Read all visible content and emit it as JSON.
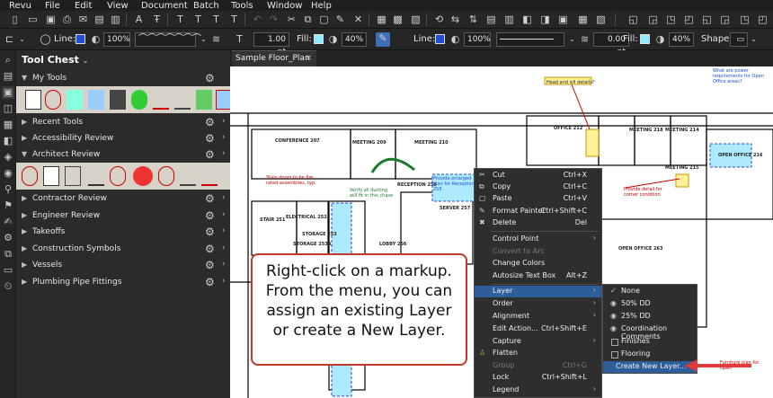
{
  "menubar": {
    "items": [
      "Revu",
      "File",
      "Edit",
      "View",
      "Document",
      "Batch",
      "Tools",
      "Window",
      "Help"
    ]
  },
  "toolbar2": {
    "line_label": "Line:",
    "line_zoom": "100%",
    "stroke_width": "1.00 pt",
    "fill_label": "Fill:",
    "fill_opacity": "40%",
    "line2_label": "Line:",
    "line2_zoom": "100%",
    "stroke2_width": "0.00 pt",
    "fill2_label": "Fill:",
    "fill2_opacity": "40%",
    "shape_label": "Shape:",
    "colors": {
      "line": "#1f4fd6",
      "fill": "#8fe8ff"
    }
  },
  "toolchest": {
    "title": "Tool Chest",
    "sections": [
      "My Tools",
      "Recent Tools",
      "Accessibility Review",
      "Architect Review",
      "Contractor Review",
      "Engineer Review",
      "Takeoffs",
      "Construction Symbols",
      "Vessels",
      "Plumbing Pipe Fittings"
    ]
  },
  "tab": {
    "label": "Sample Floor_Plan",
    "close": "×"
  },
  "context_menu": {
    "items": [
      {
        "label": "Cut",
        "shortcut": "Ctrl+X",
        "icon": "scissors-icon",
        "disabled": false
      },
      {
        "label": "Copy",
        "shortcut": "Ctrl+C",
        "icon": "copy-icon",
        "disabled": false
      },
      {
        "label": "Paste",
        "shortcut": "Ctrl+V",
        "icon": "paste-icon",
        "disabled": false
      },
      {
        "label": "Format Painter",
        "shortcut": "Ctrl+Shift+C",
        "icon": "brush-icon",
        "disabled": false
      },
      {
        "label": "Delete",
        "shortcut": "Del",
        "icon": "delete-icon",
        "disabled": false
      },
      {
        "label": "Control Point",
        "shortcut": "",
        "submenu": true,
        "disabled": false
      },
      {
        "label": "Convert to Arc",
        "shortcut": "",
        "disabled": true
      },
      {
        "label": "Change Colors",
        "shortcut": "",
        "disabled": false
      },
      {
        "label": "Autosize Text Box",
        "shortcut": "Alt+Z",
        "disabled": false
      },
      {
        "label": "Layer",
        "shortcut": "",
        "submenu": true,
        "selected": true,
        "disabled": false
      },
      {
        "label": "Order",
        "shortcut": "",
        "submenu": true,
        "disabled": false
      },
      {
        "label": "Alignment",
        "shortcut": "",
        "submenu": true,
        "disabled": false
      },
      {
        "label": "Edit Action...",
        "shortcut": "Ctrl+Shift+E",
        "disabled": false
      },
      {
        "label": "Capture",
        "shortcut": "",
        "submenu": true,
        "disabled": false
      },
      {
        "label": "Flatten",
        "shortcut": "",
        "icon": "flatten-icon",
        "disabled": false
      },
      {
        "label": "Group",
        "shortcut": "Ctrl+G",
        "disabled": true
      },
      {
        "label": "Lock",
        "shortcut": "Ctrl+Shift+L",
        "disabled": false
      },
      {
        "label": "Legend",
        "shortcut": "",
        "submenu": true,
        "disabled": false
      }
    ]
  },
  "layer_submenu": {
    "items": [
      {
        "label": "None",
        "state": "checked"
      },
      {
        "label": "50% DD",
        "state": "visible"
      },
      {
        "label": "25% DD",
        "state": "visible"
      },
      {
        "label": "Coordination Comments",
        "state": "visible"
      },
      {
        "label": "Finishes",
        "state": "box"
      },
      {
        "label": "Flooring",
        "state": "box"
      },
      {
        "label": "Create New Layer...",
        "state": "selected"
      }
    ]
  },
  "callout": {
    "lines": [
      "Right-click on a markup.",
      "From the menu, you can",
      "assign an existing Layer",
      "or create a New Layer."
    ]
  },
  "floorplan": {
    "rooms": [
      "CONFERENCE 207",
      "MEETING 209",
      "MEETING 210",
      "MEETING 218",
      "OFFICE 212",
      "MEETING 214",
      "MEETING 215",
      "OPEN OFFICE 216",
      "OPEN OFFICE 263",
      "RECEPTION 255",
      "SERVER 257",
      "LOBBY 256",
      "STAIR 251",
      "ELECTRICAL 252",
      "STORAGE 253A",
      "STORAGE 253"
    ],
    "notes": [
      "Head and sill details?",
      "What are power requirements for Open Office areas?",
      "Stain doors to be fire rated assemblies, typ.",
      "Verify all ducting will fit in this chase",
      "Provide enlarged plan for Reception 255",
      "Provide detail for corner condition",
      "Furniture plan for Open"
    ]
  }
}
